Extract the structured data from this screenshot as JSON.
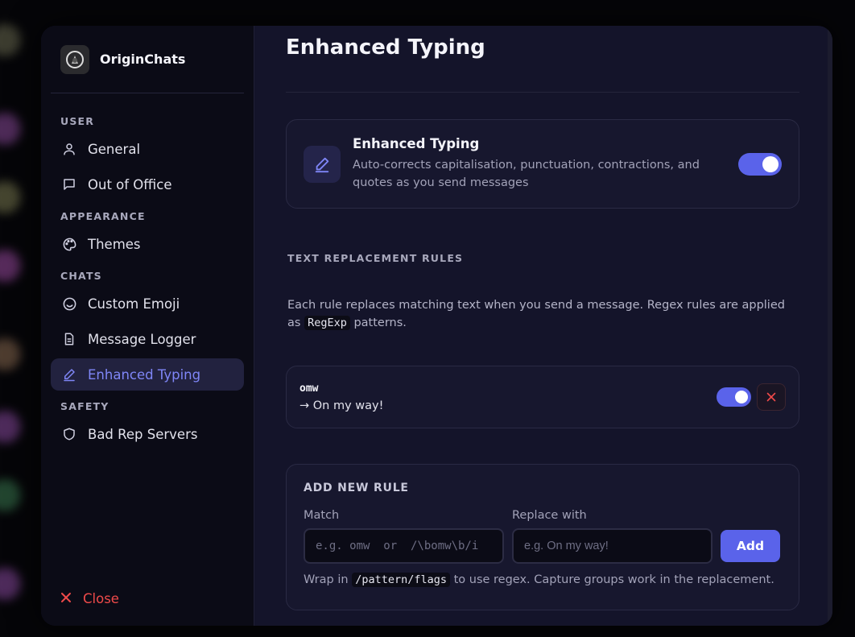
{
  "brand": {
    "name": "OriginChats"
  },
  "sidebar": {
    "sections": [
      {
        "label": "USER",
        "items": [
          {
            "label": "General",
            "icon": "user-icon"
          },
          {
            "label": "Out of Office",
            "icon": "message-icon"
          }
        ]
      },
      {
        "label": "APPEARANCE",
        "items": [
          {
            "label": "Themes",
            "icon": "palette-icon"
          }
        ]
      },
      {
        "label": "CHATS",
        "items": [
          {
            "label": "Custom Emoji",
            "icon": "smiley-icon"
          },
          {
            "label": "Message Logger",
            "icon": "document-icon"
          },
          {
            "label": "Enhanced Typing",
            "icon": "pen-icon",
            "active": true
          }
        ]
      },
      {
        "label": "SAFETY",
        "items": [
          {
            "label": "Bad Rep Servers",
            "icon": "shield-icon"
          }
        ]
      }
    ],
    "close_label": "Close"
  },
  "main": {
    "title": "Enhanced Typing",
    "feature": {
      "title": "Enhanced Typing",
      "description": "Auto-corrects capitalisation, punctuation, contractions, and quotes as you send messages",
      "enabled": true
    },
    "rules_label": "TEXT REPLACEMENT RULES",
    "rules_desc_before": "Each rule replaces matching text when you send a message. Regex rules are applied as ",
    "rules_desc_code": "RegExp",
    "rules_desc_after": " patterns.",
    "rules": [
      {
        "match": "omw",
        "replace": "→ On my way!",
        "enabled": true
      }
    ],
    "add_rule": {
      "title": "ADD NEW RULE",
      "match_label": "Match",
      "match_placeholder": "e.g. omw  or  /\\bomw\\b/i",
      "replace_label": "Replace with",
      "replace_placeholder": "e.g. On my way!",
      "add_label": "Add",
      "hint_before": "Wrap in ",
      "hint_code": "/pattern/flags",
      "hint_after": " to use regex. Capture groups work in the replacement."
    }
  },
  "colors": {
    "accent": "#5a63ea",
    "active_text": "#7f86f7",
    "danger": "#ef4a4a"
  }
}
